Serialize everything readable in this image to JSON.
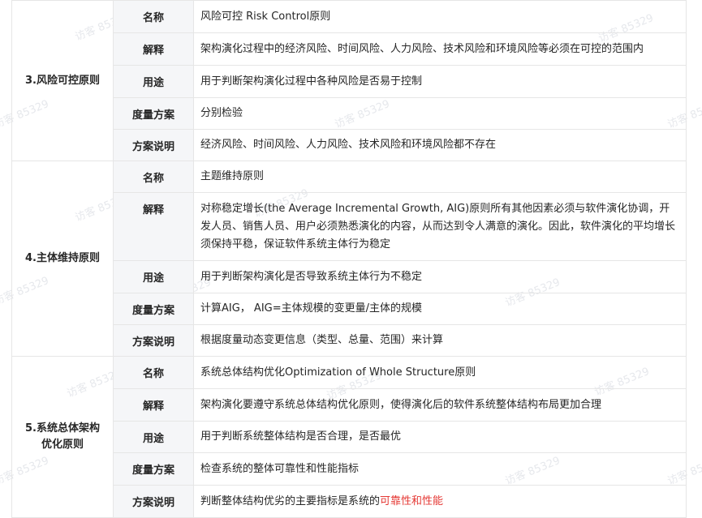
{
  "sections": [
    {
      "group": "3.风险可控原则",
      "rows": [
        {
          "key": "名称",
          "value": "风险可控 Risk Control原则"
        },
        {
          "key": "解释",
          "value": "架构演化过程中的经济风险、时间风险、人力风险、技术风险和环境风险等必须在可控的范围内"
        },
        {
          "key": "用途",
          "value": "用于判断架构演化过程中各种风险是否易于控制"
        },
        {
          "key": "度量方案",
          "value": "分别检验"
        },
        {
          "key": "方案说明",
          "value": "经济风险、时间风险、人力风险、技术风险和环境风险都不存在"
        }
      ]
    },
    {
      "group": "4.主体维持原则",
      "rows": [
        {
          "key": "名称",
          "value": "主题维持原则"
        },
        {
          "key": "解释",
          "value": "对称稳定增长(the Average Incremental Growth, AIG)原则所有其他因素必须与软件演化协调，开发人员、销售人员、用户必须熟悉演化的内容，从而达到令人满意的演化。因此，软件演化的平均增长须保持平稳，保证软件系统主体行为稳定"
        },
        {
          "key": "用途",
          "value": "用于判断架构演化是否导致系统主体行为不稳定"
        },
        {
          "key": "度量方案",
          "value": "计算AIG， AIG=主体规模的变更量/主体的规模"
        },
        {
          "key": "方案说明",
          "value": "根据度量动态变更信息（类型、总量、范围）来计算"
        }
      ]
    },
    {
      "group_line1": "5.系统总体架构",
      "group_line2": "优化原则",
      "rows": [
        {
          "key": "名称",
          "value": "系统总体结构优化Optimization of Whole Structure原则"
        },
        {
          "key": "解释",
          "value": "架构演化要遵守系统总体结构优化原则，使得演化后的软件系统整体结构布局更加合理"
        },
        {
          "key": "用途",
          "value": "用于判断系统整体结构是否合理，是否最优"
        },
        {
          "key": "度量方案",
          "value": "检查系统的整体可靠性和性能指标"
        },
        {
          "key": "方案说明",
          "value": "判断整体结构优劣的主要指标是系统的",
          "value_highlight": "可靠性和性能"
        }
      ]
    }
  ],
  "watermark": "访客 85329",
  "colors": {
    "highlight": "#e53935",
    "key_bg": "#f5f6f8",
    "border": "#e6e6e6"
  }
}
